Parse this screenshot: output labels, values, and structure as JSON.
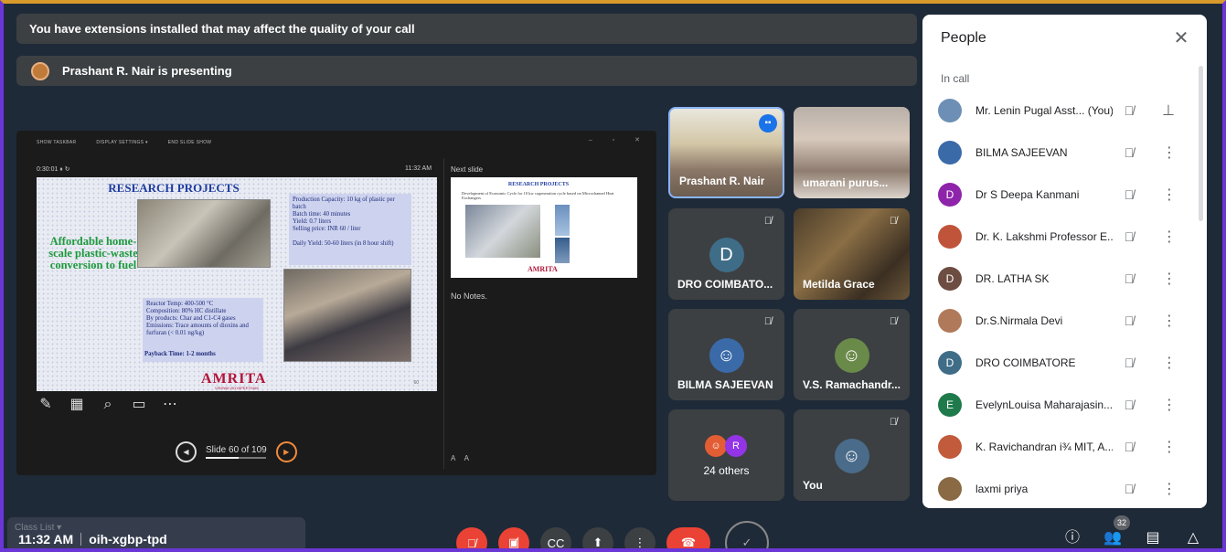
{
  "banners": {
    "extensions": "You have extensions installed that may affect the quality of your call",
    "presenting": "Prashant R. Nair is presenting"
  },
  "presentation": {
    "toolbar": [
      "SHOW TASKBAR",
      "DISPLAY SETTINGS ▾",
      "END SLIDE SHOW"
    ],
    "window_controls": "– ▫ ✕",
    "timer": "0:30:01  ⏸  ↻",
    "clock": "11:32 AM",
    "next_slide_label": "Next slide",
    "notes": "No Notes.",
    "font_adjust": "A A",
    "slide_counter": "Slide 60 of 109",
    "main_slide": {
      "title": "RESEARCH PROJECTS",
      "green_text": "Affordable home-scale plastic-waste conversion to fuel",
      "spec1": [
        "Production Capacity: 10 kg of plastic per batch",
        "Batch time: 40 minutes",
        "Yield: 0.7 liters",
        "Selling price: INR 60 / liter",
        "",
        "Daily Yield: 50-60 liters (in 8 hour shift)"
      ],
      "spec2": [
        "Reactor Temp: 400-500 °C",
        "Composition: 80% HC distillate",
        "By products: Char and C1-C4 gases",
        "Emissions: Trace amounts of dioxins and furfuran (< 0.01 ng/kg)"
      ],
      "payback": "Payback Time: 1-2 months",
      "logo": "AMRITA",
      "logo_sub": "VISHWA VIDYAPEETHAM",
      "page": "60"
    },
    "next_slide": {
      "title": "RESEARCH PROJECTS",
      "subtitle": "Development of Economic Cycle for 10 kw cogeneration cycle based on Microchannel Heat Exchangers",
      "logo": "AMRITA"
    }
  },
  "tiles": [
    {
      "id": "prashant",
      "name": "Prashant R. Nair",
      "speaking": true
    },
    {
      "id": "umarani",
      "name": "umarani purus..."
    },
    {
      "id": "dro",
      "name": "DRO COIMBATO...",
      "initial": "D",
      "muted": true
    },
    {
      "id": "metilda",
      "name": "Metilda Grace",
      "muted": true
    },
    {
      "id": "bilma",
      "name": "BILMA SAJEEVAN",
      "muted": true
    },
    {
      "id": "vs",
      "name": "V.S. Ramachandr...",
      "muted": true
    },
    {
      "id": "others",
      "name": "24 others",
      "mini_initial": "R"
    },
    {
      "id": "you",
      "name": "You",
      "muted": true
    }
  ],
  "people_panel": {
    "title": "People",
    "section": "In call",
    "participants": [
      {
        "name": "Mr. Lenin Pugal Asst...",
        "suffix": "(You)",
        "initial": "",
        "color": "#6d8fb5",
        "action": "pin"
      },
      {
        "name": "BILMA SAJEEVAN",
        "initial": "",
        "color": "#3b6aa8",
        "action": "more"
      },
      {
        "name": "Dr S Deepa Kanmani",
        "initial": "D",
        "color": "#8e24aa",
        "action": "more"
      },
      {
        "name": "Dr. K. Lakshmi Professor E...",
        "initial": "",
        "color": "#c0543a",
        "action": "more"
      },
      {
        "name": "DR. LATHA SK",
        "initial": "D",
        "color": "#6d4c41",
        "action": "more"
      },
      {
        "name": "Dr.S.Nirmala Devi",
        "initial": "",
        "color": "#b07a5a",
        "action": "more"
      },
      {
        "name": "DRO COIMBATORE",
        "initial": "D",
        "color": "#3f6d88",
        "action": "more"
      },
      {
        "name": "EvelynLouisa Maharajasin...",
        "initial": "E",
        "color": "#1e7a4a",
        "action": "more"
      },
      {
        "name": "K. Ravichandran i¾ MIT, A...",
        "initial": "",
        "color": "#c25b3c",
        "action": "more"
      },
      {
        "name": "laxmi priya",
        "initial": "",
        "color": "#8a6a45",
        "action": "more"
      }
    ]
  },
  "bottom_bar": {
    "time": "11:32 AM",
    "meeting_code": "oih-xgbp-tpd",
    "taskbar_ghost": "Class List ▾",
    "people_count": "32"
  },
  "icons": {
    "mic_off": "mic-off-icon",
    "cam_off": "camera-off-icon",
    "captions": "captions-icon",
    "present": "present-icon",
    "more": "more-vert-icon",
    "end_call": "end-call-icon",
    "info": "info-icon",
    "people": "people-icon",
    "chat": "chat-icon",
    "activities": "activities-icon"
  },
  "colors": {
    "end_call": "#ea4335",
    "accent": "#1a73e8",
    "next_arrow": "#f28b3b"
  }
}
